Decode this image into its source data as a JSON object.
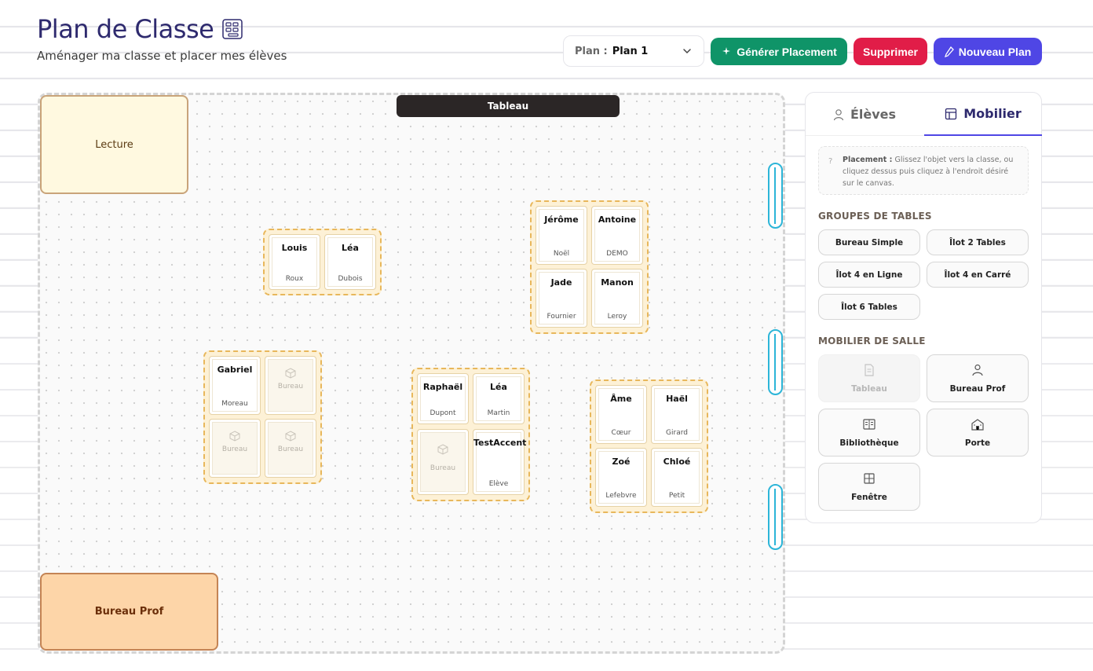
{
  "header": {
    "title": "Plan de Classe",
    "subtitle": "Aménager ma classe et placer mes élèves"
  },
  "toolbar": {
    "plan_label": "Plan :",
    "plan_value": "Plan 1",
    "generate_label": "Générer Placement",
    "delete_label": "Supprimer",
    "new_plan_label": "Nouveau Plan"
  },
  "classroom": {
    "board_label": "Tableau",
    "reading_zone_label": "Lecture",
    "teacher_desk_label": "Bureau Prof",
    "empty_desk_label": "Bureau",
    "groups": [
      {
        "desks": [
          {
            "first": "Louis",
            "last": "Roux"
          },
          {
            "first": "Léa",
            "last": "Dubois"
          }
        ]
      },
      {
        "desks": [
          {
            "first": "Jérôme",
            "last": "Noël"
          },
          {
            "first": "Antoine",
            "last": "DEMO"
          },
          {
            "first": "Jade",
            "last": "Fournier"
          },
          {
            "first": "Manon",
            "last": "Leroy"
          }
        ]
      },
      {
        "desks": [
          {
            "first": "Gabriel",
            "last": "Moreau"
          },
          {
            "empty": true
          },
          {
            "empty": true
          },
          {
            "empty": true
          }
        ]
      },
      {
        "desks": [
          {
            "first": "Raphaël",
            "last": "Dupont"
          },
          {
            "first": "Léa",
            "last": "Martin"
          },
          {
            "empty": true
          },
          {
            "first": "TestAccent",
            "last": "Elève"
          }
        ]
      },
      {
        "desks": [
          {
            "first": "Âme",
            "last": "Cœur"
          },
          {
            "first": "Haël",
            "last": "Girard"
          },
          {
            "first": "Zoé",
            "last": "Lefebvre"
          },
          {
            "first": "Chloé",
            "last": "Petit"
          }
        ]
      }
    ]
  },
  "panel": {
    "tabs": [
      {
        "label": "Élèves"
      },
      {
        "label": "Mobilier"
      }
    ],
    "active_tab": "Mobilier",
    "info_bold": "Placement :",
    "info_text": "Glissez l'objet vers la classe, ou cliquez dessus puis cliquez à l'endroit désiré sur le canvas.",
    "groups_title": "GROUPES DE TABLES",
    "table_groups": [
      "Bureau Simple",
      "Îlot 2 Tables",
      "Îlot 4 en Ligne",
      "Îlot 4 en Carré",
      "Îlot 6 Tables"
    ],
    "furniture_title": "MOBILIER DE SALLE",
    "furniture": [
      {
        "label": "Tableau",
        "icon": "document-icon",
        "disabled": true
      },
      {
        "label": "Bureau Prof",
        "icon": "person-icon"
      },
      {
        "label": "Bibliothèque",
        "icon": "book-icon"
      },
      {
        "label": "Porte",
        "icon": "school-icon"
      },
      {
        "label": "Fenêtre",
        "icon": "window-icon"
      }
    ]
  },
  "colors": {
    "primary": "#4f46e5",
    "success": "#0f9468",
    "danger": "#e11d48",
    "title": "#2e2a6e",
    "group_border": "#e8b75b",
    "window": "#2cb5d8"
  }
}
